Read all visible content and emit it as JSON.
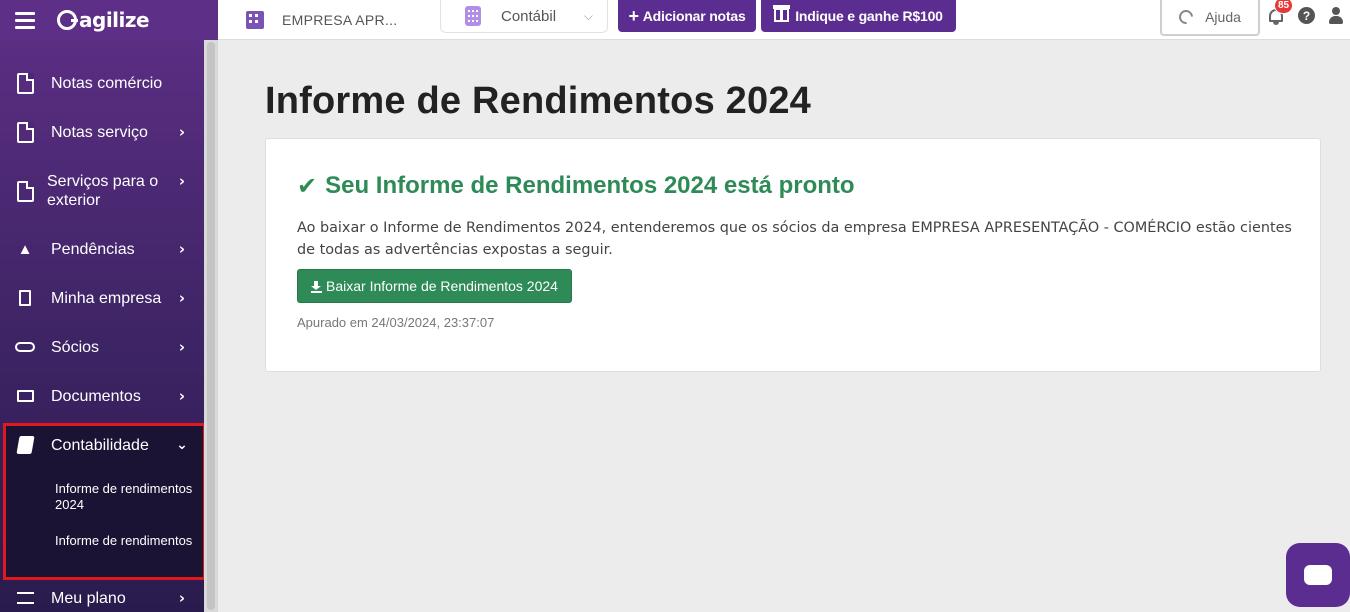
{
  "app": {
    "logo": "agilize"
  },
  "topbar": {
    "company": "EMPRESA APR...",
    "module": "Contábil",
    "add_notes": "Adicionar notas",
    "referral": "Indique e ganhe R$100",
    "help": "Ajuda",
    "notifications_count": "85"
  },
  "sidebar": {
    "items": [
      {
        "label": "Notas comércio"
      },
      {
        "label": "Notas serviço"
      },
      {
        "label": "Serviços para o exterior"
      },
      {
        "label": "Pendências"
      },
      {
        "label": "Minha empresa"
      },
      {
        "label": "Sócios"
      },
      {
        "label": "Documentos"
      },
      {
        "label": "Contabilidade"
      },
      {
        "label": "Meu plano"
      }
    ],
    "subitems": [
      {
        "label": "Informe de rendimentos 2024"
      },
      {
        "label": "Informe de rendimentos"
      }
    ]
  },
  "main": {
    "title": "Informe de Rendimentos 2024",
    "card": {
      "heading": "Seu Informe de Rendimentos 2024 está pronto",
      "text": "Ao baixar o Informe de Rendimentos 2024, entenderemos que os sócios da empresa EMPRESA APRESENTAÇÃO - COMÉRCIO estão cientes de todas as advertências expostas a seguir.",
      "download_label": "Baixar Informe de Rendimentos 2024",
      "date": "Apurado em 24/03/2024, 23:37:07"
    }
  },
  "colors": {
    "brand": "#5c2d91",
    "success": "#2e8b57",
    "highlight": "#e0191e"
  }
}
